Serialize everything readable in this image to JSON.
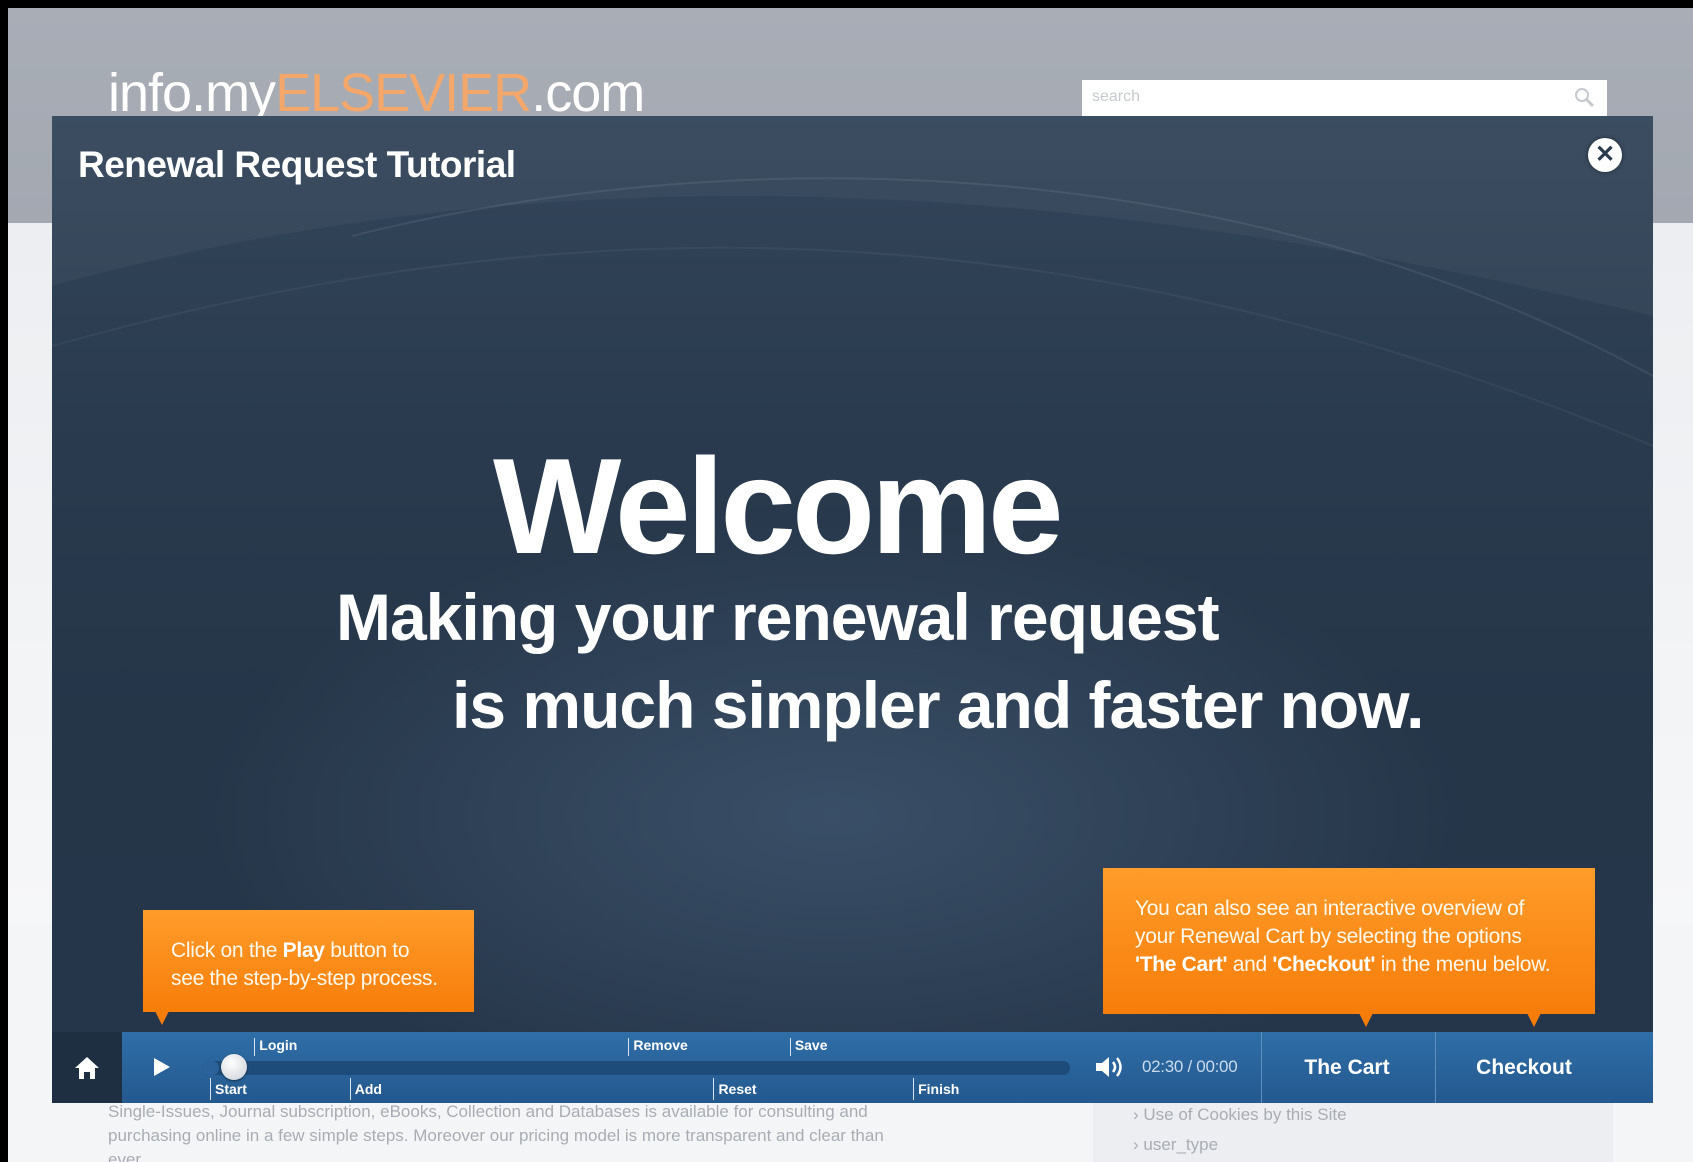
{
  "background_page": {
    "logo_prefix": "info.my",
    "logo_accent": "ELSEVIER",
    "logo_suffix": ".com",
    "search_placeholder": "search",
    "body_text_line1": "Single-Issues, Journal subscription, eBooks, Collection and Databases is available for consulting and",
    "body_text_line2": "purchasing online in a few simple steps. Moreover our pricing model is more transparent and clear than",
    "body_text_line3": "ever.",
    "side_items": [
      "Use of Cookies by this Site",
      "user_type"
    ]
  },
  "modal": {
    "title": "Renewal Request Tutorial",
    "close_icon": "close-icon",
    "welcome": "Welcome",
    "subtitle_line1": "Making your renewal request",
    "subtitle_line2": "is much simpler and faster now.",
    "tooltip_play": {
      "text_before": "Click on the ",
      "bold": "Play",
      "text_after": " button to see the step-by-step process."
    },
    "tooltip_cart": {
      "text_before": "You can also see an interactive overview of your Renewal Cart by selecting the options ",
      "bold1": "'The Cart'",
      "text_mid": " and ",
      "bold2": "'Checkout'",
      "text_after": " in the menu below."
    }
  },
  "controls": {
    "home_icon": "home-icon",
    "play_icon": "play-icon",
    "volume_icon": "volume-icon",
    "time": "02:30 / 00:00",
    "progress": 0.02,
    "markers_top": [
      {
        "label": "Login",
        "pos": 0.051
      },
      {
        "label": "Remove",
        "pos": 0.482
      },
      {
        "label": "Save",
        "pos": 0.668
      }
    ],
    "markers_bottom": [
      {
        "label": "Start",
        "pos": 0.0
      },
      {
        "label": "Add",
        "pos": 0.161
      },
      {
        "label": "Reset",
        "pos": 0.58
      },
      {
        "label": "Finish",
        "pos": 0.81
      }
    ],
    "cart_label": "The Cart",
    "checkout_label": "Checkout"
  },
  "colors": {
    "modal_bg": "#2a3b4f",
    "bar_blue": "#2f6ea8",
    "tooltip_orange": "#f88d14",
    "logo_accent": "#f4a76b"
  }
}
